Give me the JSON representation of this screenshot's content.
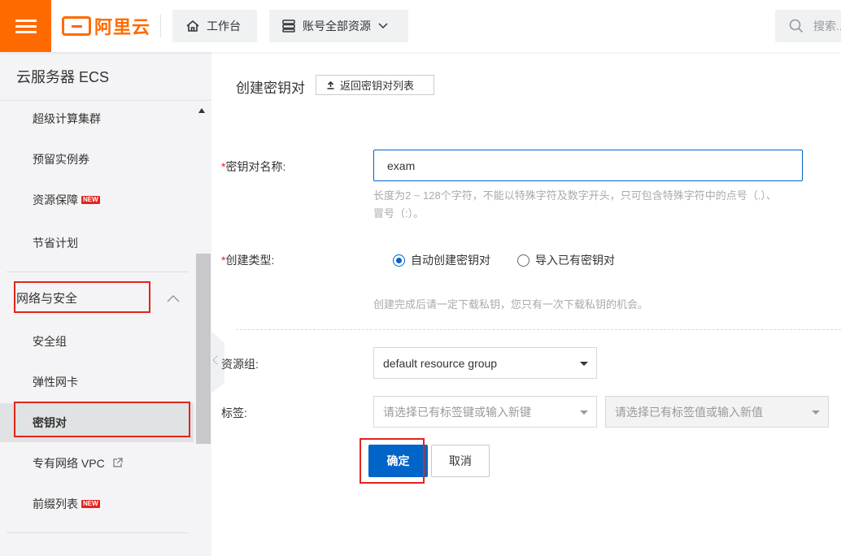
{
  "topbar": {
    "brand_text": "阿里云",
    "workbench_label": "工作台",
    "account_scope_label": "账号全部资源",
    "search_placeholder": "搜索..."
  },
  "sidebar": {
    "title": "云服务器 ECS",
    "items_upper": [
      {
        "label": "超级计算集群",
        "badge": ""
      },
      {
        "label": "预留实例券",
        "badge": ""
      },
      {
        "label": "资源保障",
        "badge": "NEW"
      },
      {
        "label": "节省计划",
        "badge": ""
      }
    ],
    "group_label": "网络与安全",
    "group_items": [
      {
        "label": "安全组",
        "badge": ""
      },
      {
        "label": "弹性网卡",
        "badge": ""
      },
      {
        "label": "密钥对",
        "badge": "",
        "active": true
      },
      {
        "label": "专有网络 VPC",
        "badge": "",
        "external": true
      },
      {
        "label": "前缀列表",
        "badge": "NEW"
      }
    ]
  },
  "form": {
    "page_title": "创建密钥对",
    "back_label": "返回密钥对列表",
    "name_label": "密钥对名称:",
    "name_value": "exam",
    "name_help_line1": "长度为2 ~ 128个字符，不能以特殊字符及数字开头，只可包含特殊字符中的点号（.）、",
    "name_help_line2": "冒号（:）。",
    "type_label": "创建类型:",
    "type_options": [
      {
        "label": "自动创建密钥对",
        "selected": true
      },
      {
        "label": "导入已有密钥对",
        "selected": false
      }
    ],
    "type_help": "创建完成后请一定下载私钥，您只有一次下载私钥的机会。",
    "resource_group_label": "资源组:",
    "resource_group_value": "default resource group",
    "tag_label": "标签:",
    "tag_key_placeholder": "请选择已有标签键或输入新键",
    "tag_value_placeholder": "请选择已有标签值或输入新值",
    "required_mark": "*",
    "confirm_label": "确定",
    "cancel_label": "取消"
  },
  "colors": {
    "brand": "#ff6a00",
    "primary": "#0064c8",
    "highlight": "#e1251b"
  }
}
